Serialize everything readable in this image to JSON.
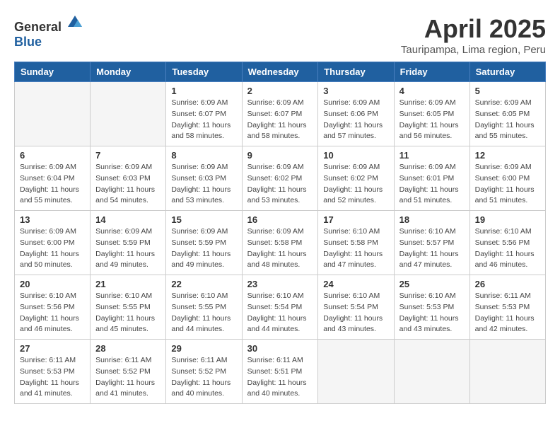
{
  "header": {
    "logo_general": "General",
    "logo_blue": "Blue",
    "title": "April 2025",
    "location": "Tauripampa, Lima region, Peru"
  },
  "columns": [
    "Sunday",
    "Monday",
    "Tuesday",
    "Wednesday",
    "Thursday",
    "Friday",
    "Saturday"
  ],
  "weeks": [
    [
      {
        "day": "",
        "detail": ""
      },
      {
        "day": "",
        "detail": ""
      },
      {
        "day": "1",
        "detail": "Sunrise: 6:09 AM\nSunset: 6:07 PM\nDaylight: 11 hours and 58 minutes."
      },
      {
        "day": "2",
        "detail": "Sunrise: 6:09 AM\nSunset: 6:07 PM\nDaylight: 11 hours and 58 minutes."
      },
      {
        "day": "3",
        "detail": "Sunrise: 6:09 AM\nSunset: 6:06 PM\nDaylight: 11 hours and 57 minutes."
      },
      {
        "day": "4",
        "detail": "Sunrise: 6:09 AM\nSunset: 6:05 PM\nDaylight: 11 hours and 56 minutes."
      },
      {
        "day": "5",
        "detail": "Sunrise: 6:09 AM\nSunset: 6:05 PM\nDaylight: 11 hours and 55 minutes."
      }
    ],
    [
      {
        "day": "6",
        "detail": "Sunrise: 6:09 AM\nSunset: 6:04 PM\nDaylight: 11 hours and 55 minutes."
      },
      {
        "day": "7",
        "detail": "Sunrise: 6:09 AM\nSunset: 6:03 PM\nDaylight: 11 hours and 54 minutes."
      },
      {
        "day": "8",
        "detail": "Sunrise: 6:09 AM\nSunset: 6:03 PM\nDaylight: 11 hours and 53 minutes."
      },
      {
        "day": "9",
        "detail": "Sunrise: 6:09 AM\nSunset: 6:02 PM\nDaylight: 11 hours and 53 minutes."
      },
      {
        "day": "10",
        "detail": "Sunrise: 6:09 AM\nSunset: 6:02 PM\nDaylight: 11 hours and 52 minutes."
      },
      {
        "day": "11",
        "detail": "Sunrise: 6:09 AM\nSunset: 6:01 PM\nDaylight: 11 hours and 51 minutes."
      },
      {
        "day": "12",
        "detail": "Sunrise: 6:09 AM\nSunset: 6:00 PM\nDaylight: 11 hours and 51 minutes."
      }
    ],
    [
      {
        "day": "13",
        "detail": "Sunrise: 6:09 AM\nSunset: 6:00 PM\nDaylight: 11 hours and 50 minutes."
      },
      {
        "day": "14",
        "detail": "Sunrise: 6:09 AM\nSunset: 5:59 PM\nDaylight: 11 hours and 49 minutes."
      },
      {
        "day": "15",
        "detail": "Sunrise: 6:09 AM\nSunset: 5:59 PM\nDaylight: 11 hours and 49 minutes."
      },
      {
        "day": "16",
        "detail": "Sunrise: 6:09 AM\nSunset: 5:58 PM\nDaylight: 11 hours and 48 minutes."
      },
      {
        "day": "17",
        "detail": "Sunrise: 6:10 AM\nSunset: 5:58 PM\nDaylight: 11 hours and 47 minutes."
      },
      {
        "day": "18",
        "detail": "Sunrise: 6:10 AM\nSunset: 5:57 PM\nDaylight: 11 hours and 47 minutes."
      },
      {
        "day": "19",
        "detail": "Sunrise: 6:10 AM\nSunset: 5:56 PM\nDaylight: 11 hours and 46 minutes."
      }
    ],
    [
      {
        "day": "20",
        "detail": "Sunrise: 6:10 AM\nSunset: 5:56 PM\nDaylight: 11 hours and 46 minutes."
      },
      {
        "day": "21",
        "detail": "Sunrise: 6:10 AM\nSunset: 5:55 PM\nDaylight: 11 hours and 45 minutes."
      },
      {
        "day": "22",
        "detail": "Sunrise: 6:10 AM\nSunset: 5:55 PM\nDaylight: 11 hours and 44 minutes."
      },
      {
        "day": "23",
        "detail": "Sunrise: 6:10 AM\nSunset: 5:54 PM\nDaylight: 11 hours and 44 minutes."
      },
      {
        "day": "24",
        "detail": "Sunrise: 6:10 AM\nSunset: 5:54 PM\nDaylight: 11 hours and 43 minutes."
      },
      {
        "day": "25",
        "detail": "Sunrise: 6:10 AM\nSunset: 5:53 PM\nDaylight: 11 hours and 43 minutes."
      },
      {
        "day": "26",
        "detail": "Sunrise: 6:11 AM\nSunset: 5:53 PM\nDaylight: 11 hours and 42 minutes."
      }
    ],
    [
      {
        "day": "27",
        "detail": "Sunrise: 6:11 AM\nSunset: 5:53 PM\nDaylight: 11 hours and 41 minutes."
      },
      {
        "day": "28",
        "detail": "Sunrise: 6:11 AM\nSunset: 5:52 PM\nDaylight: 11 hours and 41 minutes."
      },
      {
        "day": "29",
        "detail": "Sunrise: 6:11 AM\nSunset: 5:52 PM\nDaylight: 11 hours and 40 minutes."
      },
      {
        "day": "30",
        "detail": "Sunrise: 6:11 AM\nSunset: 5:51 PM\nDaylight: 11 hours and 40 minutes."
      },
      {
        "day": "",
        "detail": ""
      },
      {
        "day": "",
        "detail": ""
      },
      {
        "day": "",
        "detail": ""
      }
    ]
  ]
}
